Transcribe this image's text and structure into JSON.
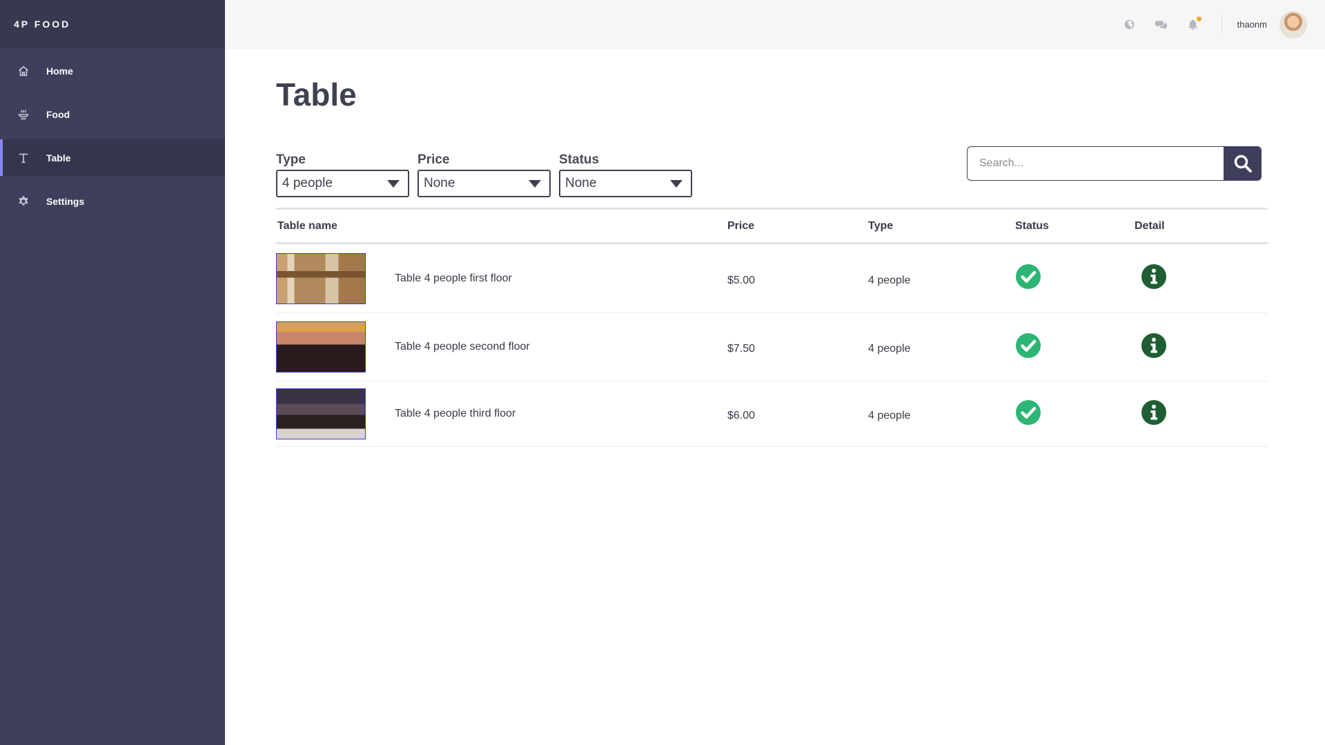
{
  "sidebar": {
    "brand": "4P FOOD",
    "items": [
      {
        "label": "Home",
        "icon": "home-icon"
      },
      {
        "label": "Food",
        "icon": "food-bowl-icon"
      },
      {
        "label": "Table",
        "icon": "table-icon",
        "active": true
      },
      {
        "label": "Settings",
        "icon": "gear-icon"
      }
    ]
  },
  "topbar": {
    "icons": [
      "globe-icon",
      "chat-icon",
      "bell-icon"
    ],
    "notification_color": "#f5a623",
    "username": "thaonm"
  },
  "page": {
    "title": "Table"
  },
  "filters": {
    "type": {
      "label": "Type",
      "value": "4 people"
    },
    "price": {
      "label": "Price",
      "value": "None"
    },
    "status": {
      "label": "Status",
      "value": "None"
    }
  },
  "search": {
    "placeholder": "Search..."
  },
  "table": {
    "headers": {
      "name": "Table name",
      "price": "Price",
      "type": "Type",
      "status": "Status",
      "detail": "Detail"
    },
    "rows": [
      {
        "name": "Table 4 people first floor",
        "price": "$5.00",
        "type": "4 people",
        "status": "available"
      },
      {
        "name": "Table 4 people second floor",
        "price": "$7.50",
        "type": "4 people",
        "status": "available"
      },
      {
        "name": "Table 4 people third floor",
        "price": "$6.00",
        "type": "4 people",
        "status": "available"
      }
    ]
  },
  "colors": {
    "sidebar_bg": "#3f3e5c",
    "active_indicator": "#8a86f0",
    "status_ok": "#2bb673",
    "detail_icon": "#1e5e32"
  }
}
